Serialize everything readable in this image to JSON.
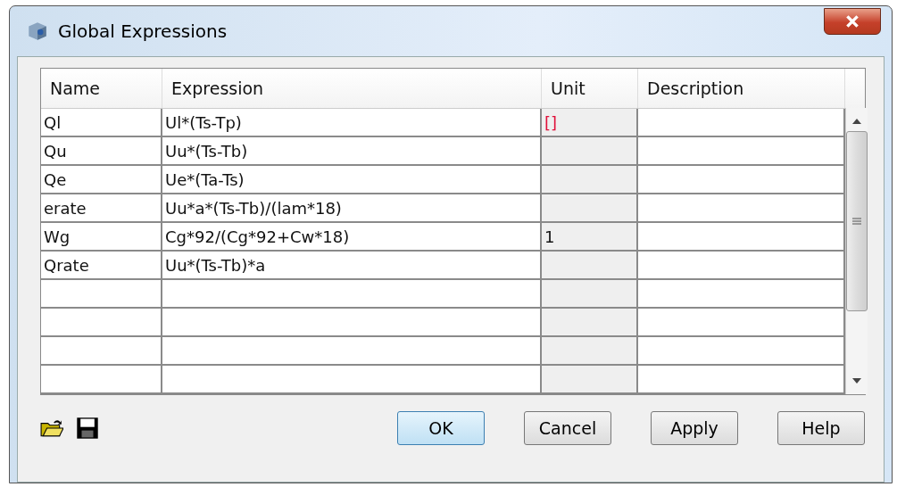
{
  "window": {
    "title": "Global Expressions"
  },
  "table": {
    "columns": [
      "Name",
      "Expression",
      "Unit",
      "Description"
    ],
    "rows": [
      {
        "name": "Ql",
        "expression": "Ul*(Ts-Tp)",
        "unit": "[]",
        "color": "#e0103a"
      },
      {
        "name": "Qu",
        "expression": "Uu*(Ts-Tb)"
      },
      {
        "name": "Qe",
        "expression": "Ue*(Ta-Ts)"
      },
      {
        "name": "erate",
        "expression": "Uu*a*(Ts-Tb)/(lam*18)"
      },
      {
        "name": "Wg",
        "expression": "Cg*92/(Cg*92+Cw*18)",
        "unit": "1"
      },
      {
        "name": "Qrate",
        "expression": "Uu*(Ts-Tb)*a"
      }
    ]
  },
  "buttons": [
    {
      "label": "OK",
      "selected": true
    },
    {
      "label": "Cancel",
      "selected": false
    },
    {
      "label": "Apply",
      "selected": false
    },
    {
      "label": "Help",
      "selected": false
    }
  ]
}
